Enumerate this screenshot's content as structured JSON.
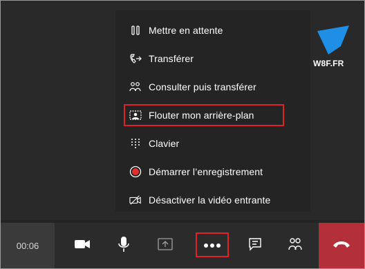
{
  "window": {
    "background": "#2d2d2f"
  },
  "menu": {
    "items": [
      {
        "label": "Mettre en attente",
        "icon": "pause-icon"
      },
      {
        "label": "Transférer",
        "icon": "transfer-phone-icon"
      },
      {
        "label": "Consulter puis transférer",
        "icon": "people-icon"
      },
      {
        "label": "Flouter mon arrière-plan",
        "icon": "blur-background-icon",
        "highlighted": true
      },
      {
        "label": "Clavier",
        "icon": "dialpad-icon"
      },
      {
        "label": "Démarrer l’enregistrement",
        "icon": "record-icon"
      },
      {
        "label": "Désactiver la vidéo entrante",
        "icon": "video-off-icon"
      }
    ],
    "highlight_color": "#e0212a"
  },
  "logo": {
    "text": "W8F.FR",
    "icon": "w8f-logo-icon",
    "color": "#1f8fe6"
  },
  "toolbar": {
    "timer": "00:06",
    "buttons": [
      {
        "name": "camera",
        "icon": "camera-icon"
      },
      {
        "name": "microphone",
        "icon": "microphone-icon"
      },
      {
        "name": "share",
        "icon": "share-screen-icon"
      },
      {
        "name": "more",
        "icon": "more-actions-icon",
        "highlighted": true
      },
      {
        "name": "chat",
        "icon": "chat-icon"
      },
      {
        "name": "participants",
        "icon": "participants-icon"
      },
      {
        "name": "hang-up",
        "icon": "hang-up-icon"
      }
    ],
    "hangup_color": "#b3303a"
  }
}
